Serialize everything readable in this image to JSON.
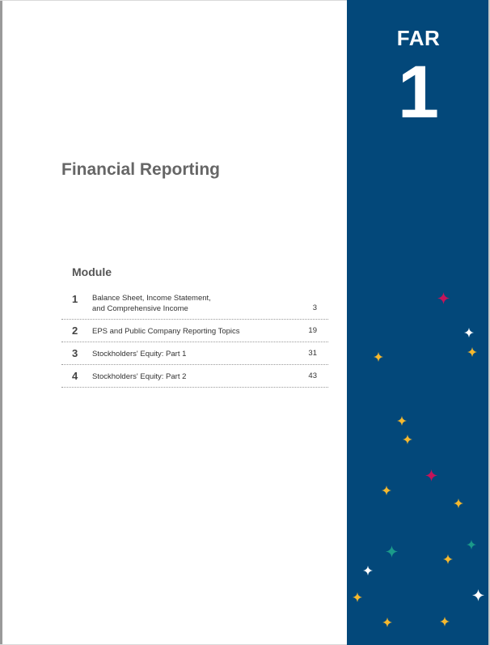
{
  "sidebar": {
    "section_code": "FAR",
    "section_number": "1"
  },
  "title": "Financial Reporting",
  "toc": {
    "heading": "Module",
    "items": [
      {
        "number": "1",
        "label_line1": "Balance Sheet, Income Statement,",
        "label_line2": "and Comprehensive Income",
        "page": "3"
      },
      {
        "number": "2",
        "label_line1": "EPS and Public Company Reporting Topics",
        "page": "19"
      },
      {
        "number": "3",
        "label_line1": "Stockholders' Equity: Part 1",
        "page": "31"
      },
      {
        "number": "4",
        "label_line1": "Stockholders' Equity: Part 2",
        "page": "43"
      }
    ]
  },
  "colors": {
    "panel": "#03487a",
    "spark_yellow": "#f5b82e",
    "spark_magenta": "#c4145a",
    "spark_teal": "#1b9a8a",
    "spark_white": "#ffffff"
  },
  "decoration": {
    "icon": "sparkle-icon"
  }
}
